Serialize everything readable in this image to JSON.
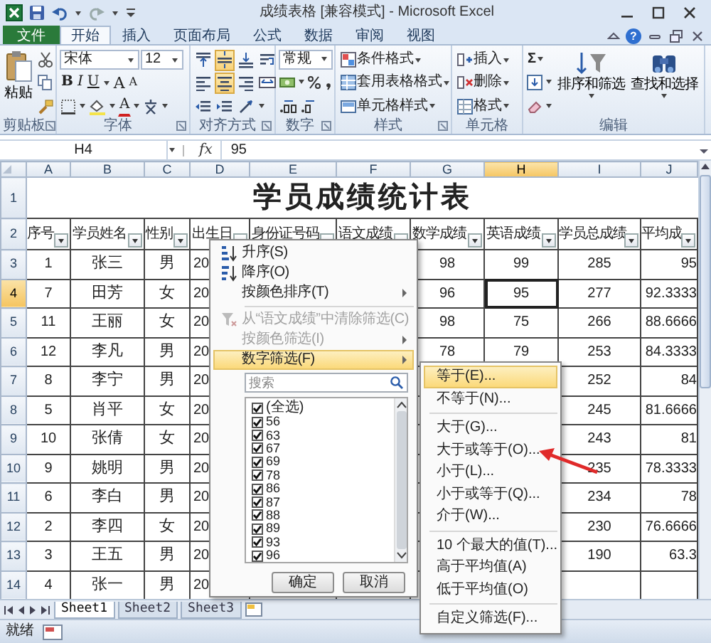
{
  "window": {
    "title": "成绩表格  [兼容模式]  -  Microsoft Excel"
  },
  "ribbon_tabs": [
    {
      "label": "文件",
      "kind": "file",
      "selected": false
    },
    {
      "label": "开始",
      "kind": "tab",
      "selected": true
    },
    {
      "label": "插入",
      "kind": "tab",
      "selected": false
    },
    {
      "label": "页面布局",
      "kind": "tab",
      "selected": false
    },
    {
      "label": "公式",
      "kind": "tab",
      "selected": false
    },
    {
      "label": "数据",
      "kind": "tab",
      "selected": false
    },
    {
      "label": "审阅",
      "kind": "tab",
      "selected": false
    },
    {
      "label": "视图",
      "kind": "tab",
      "selected": false
    }
  ],
  "help": "?",
  "ribbon": {
    "clipboard": {
      "label": "剪贴板",
      "paste": "粘贴"
    },
    "font": {
      "label": "字体",
      "font_name": "宋体",
      "font_size": "12",
      "style_buttons": [
        "B",
        "I",
        "U"
      ],
      "size_buttons": [
        "A",
        "A"
      ],
      "color_button": "A"
    },
    "alignment": {
      "label": "对齐方式",
      "buttons": [
        {
          "selected": false
        },
        {
          "selected": true
        },
        {
          "selected": false
        },
        {
          "selected": false
        },
        {
          "selected": false
        },
        {
          "selected": true
        },
        {
          "selected": false
        },
        {
          "selected": false
        },
        {
          "selected": false
        },
        {
          "selected": false
        },
        {
          "selected": false
        }
      ]
    },
    "number": {
      "label": "数字",
      "format": "常规"
    },
    "styles": {
      "label": "样式",
      "buttons": [
        "条件格式",
        "套用表格格式",
        "单元格样式"
      ]
    },
    "cells": {
      "label": "单元格",
      "buttons": [
        "插入",
        "删除",
        "格式"
      ]
    },
    "editing": {
      "label": "编辑",
      "sum": "Σ",
      "buttons": [
        "排序和筛选",
        "查找和选择"
      ]
    }
  },
  "formula_bar": {
    "name_box": "H4",
    "fx": "fx",
    "formula": "95"
  },
  "sheet": {
    "columns": [
      {
        "label": "A",
        "selected": false
      },
      {
        "label": "B",
        "selected": false
      },
      {
        "label": "C",
        "selected": false
      },
      {
        "label": "D",
        "selected": false
      },
      {
        "label": "E",
        "selected": false
      },
      {
        "label": "F",
        "selected": false
      },
      {
        "label": "G",
        "selected": false
      },
      {
        "label": "H",
        "selected": true
      },
      {
        "label": "I",
        "selected": false
      },
      {
        "label": "J",
        "selected": false
      }
    ],
    "title_row": {
      "row": "1",
      "title": "学员成绩统计表",
      "selected": false
    },
    "header_row": {
      "row": "2",
      "selected": false,
      "cells": [
        "序号",
        "学员姓名",
        "性别",
        "出生日",
        "身份证号码",
        "语文成绩",
        "数学成绩",
        "英语成绩",
        "学员总成绩",
        "平均成"
      ]
    },
    "rows": [
      {
        "row": "3",
        "selected": false,
        "cells": [
          "1",
          "张三",
          "男",
          "20",
          null,
          null,
          "98",
          "99",
          "285",
          "95"
        ]
      },
      {
        "row": "4",
        "selected": true,
        "cells": [
          "7",
          "田芳",
          "女",
          "20",
          null,
          null,
          "96",
          "95",
          "277",
          "92.3333"
        ]
      },
      {
        "row": "5",
        "selected": false,
        "cells": [
          "11",
          "王丽",
          "女",
          "20",
          null,
          null,
          "98",
          "75",
          "266",
          "88.6666"
        ]
      },
      {
        "row": "6",
        "selected": false,
        "cells": [
          "12",
          "李凡",
          "男",
          "20",
          null,
          null,
          "78",
          "79",
          "253",
          "84.3333"
        ]
      },
      {
        "row": "7",
        "selected": false,
        "cells": [
          "8",
          "李宁",
          "男",
          "20",
          null,
          null,
          null,
          null,
          "252",
          "84"
        ]
      },
      {
        "row": "8",
        "selected": false,
        "cells": [
          "5",
          "肖平",
          "女",
          "20",
          null,
          null,
          null,
          null,
          "245",
          "81.6666"
        ]
      },
      {
        "row": "9",
        "selected": false,
        "cells": [
          "10",
          "张倩",
          "女",
          "20",
          null,
          null,
          null,
          null,
          "243",
          "81"
        ]
      },
      {
        "row": "10",
        "selected": false,
        "cells": [
          "9",
          "姚明",
          "男",
          "20",
          null,
          null,
          null,
          null,
          "235",
          "78.3333"
        ]
      },
      {
        "row": "11",
        "selected": false,
        "cells": [
          "6",
          "李白",
          "男",
          "20",
          null,
          null,
          null,
          null,
          "234",
          "78"
        ]
      },
      {
        "row": "12",
        "selected": false,
        "cells": [
          "2",
          "李四",
          "女",
          "20",
          null,
          null,
          null,
          null,
          "230",
          "76.6666"
        ]
      },
      {
        "row": "13",
        "selected": false,
        "cells": [
          "3",
          "王五",
          "男",
          "20",
          null,
          null,
          null,
          null,
          "190",
          "63.3"
        ]
      },
      {
        "row": "14",
        "selected": false,
        "cells": [
          "4",
          "张一",
          "男",
          "20",
          null,
          null,
          null,
          null,
          null,
          null
        ]
      }
    ]
  },
  "filter_menu": {
    "items": [
      {
        "kind": "sort_asc",
        "label": "升序(S)",
        "disabled": false,
        "highlighted": false,
        "submenu": false
      },
      {
        "kind": "sort_desc",
        "label": "降序(O)",
        "disabled": false,
        "highlighted": false,
        "submenu": false
      },
      {
        "kind": "plain",
        "label": "按颜色排序(T)",
        "disabled": false,
        "highlighted": false,
        "submenu": true
      },
      {
        "kind": "separator"
      },
      {
        "kind": "clear_filter",
        "label": "从“语文成绩”中清除筛选(C)",
        "disabled": true,
        "highlighted": false,
        "submenu": false
      },
      {
        "kind": "plain",
        "label": "按颜色筛选(I)",
        "disabled": true,
        "highlighted": false,
        "submenu": true
      },
      {
        "kind": "plain",
        "label": "数字筛选(F)",
        "disabled": false,
        "highlighted": true,
        "submenu": true
      }
    ],
    "search": {
      "placeholder": "搜索"
    },
    "values": [
      {
        "label": "(全选)",
        "checked": true
      },
      {
        "label": "56",
        "checked": true
      },
      {
        "label": "63",
        "checked": true
      },
      {
        "label": "67",
        "checked": true
      },
      {
        "label": "69",
        "checked": true
      },
      {
        "label": "78",
        "checked": true
      },
      {
        "label": "86",
        "checked": true
      },
      {
        "label": "87",
        "checked": true
      },
      {
        "label": "88",
        "checked": true
      },
      {
        "label": "89",
        "checked": true
      },
      {
        "label": "93",
        "checked": true
      },
      {
        "label": "96",
        "checked": true
      }
    ],
    "buttons": [
      "确定",
      "取消"
    ]
  },
  "number_filter_menu": {
    "items": [
      {
        "kind": "item",
        "label": "等于(E)...",
        "highlighted": true
      },
      {
        "kind": "item",
        "label": "不等于(N)...",
        "highlighted": false
      },
      {
        "kind": "separator"
      },
      {
        "kind": "item",
        "label": "大于(G)...",
        "highlighted": false
      },
      {
        "kind": "item",
        "label": "大于或等于(O)...",
        "highlighted": false
      },
      {
        "kind": "item",
        "label": "小于(L)...",
        "highlighted": false
      },
      {
        "kind": "item",
        "label": "小于或等于(Q)...",
        "highlighted": false
      },
      {
        "kind": "item",
        "label": "介于(W)...",
        "highlighted": false
      },
      {
        "kind": "separator"
      },
      {
        "kind": "item",
        "label": "10 个最大的值(T)...",
        "highlighted": false
      },
      {
        "kind": "item",
        "label": "高于平均值(A)",
        "highlighted": false
      },
      {
        "kind": "item",
        "label": "低于平均值(O)",
        "highlighted": false
      },
      {
        "kind": "separator"
      },
      {
        "kind": "item",
        "label": "自定义筛选(F)...",
        "highlighted": false
      }
    ]
  },
  "sheet_tabs": [
    {
      "label": "Sheet1",
      "selected": true
    },
    {
      "label": "Sheet2",
      "selected": false
    },
    {
      "label": "Sheet3",
      "selected": false
    }
  ],
  "status_bar": {
    "text": "就绪"
  },
  "annotations": [
    {
      "kind": "arrow"
    }
  ]
}
